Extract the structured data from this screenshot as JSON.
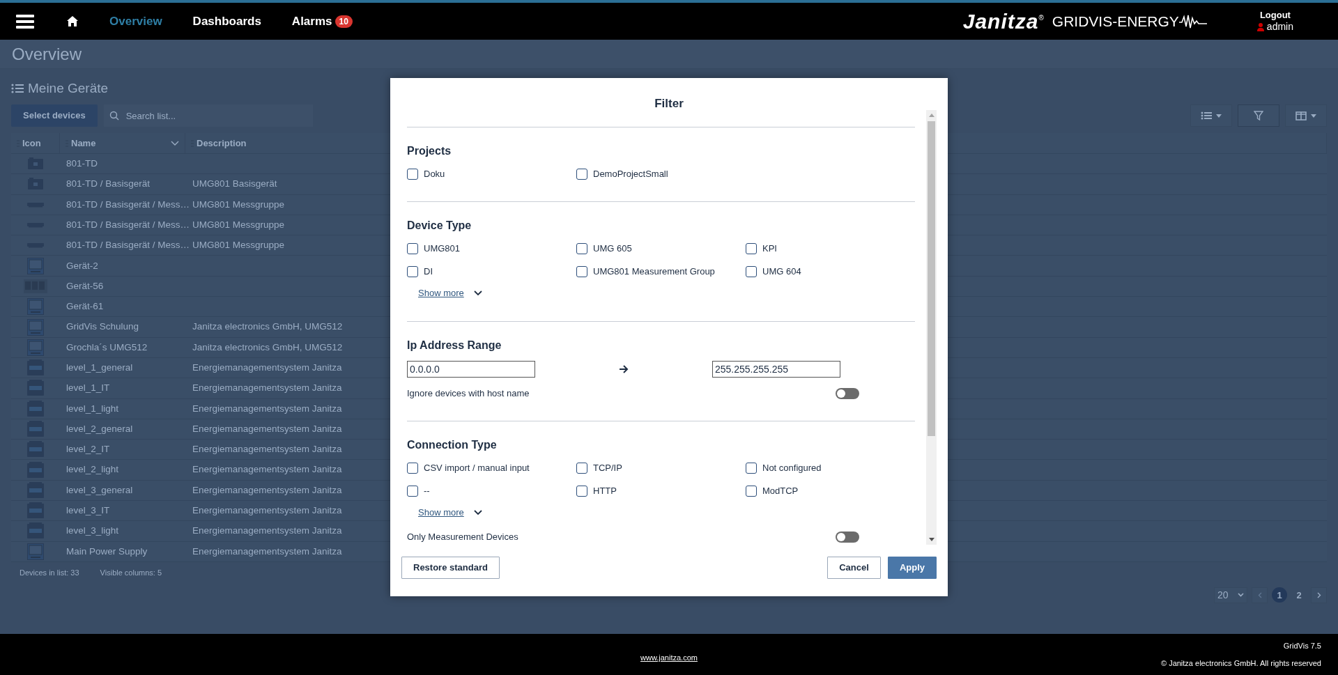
{
  "header": {
    "nav": [
      {
        "kind": "home",
        "selected": false
      },
      {
        "kind": "link",
        "label": "Overview",
        "selected": true
      },
      {
        "kind": "link",
        "label": "Dashboards",
        "selected": false
      },
      {
        "kind": "link",
        "label": "Alarms",
        "selected": false,
        "badge": "10"
      }
    ],
    "logo": {
      "brand": "Janitza",
      "mark": "®",
      "product": "GRIDVIS-ENERGY"
    },
    "user": {
      "logout": "Logout",
      "name": "admin"
    }
  },
  "page": {
    "title": "Overview",
    "list_title": "Meine Geräte",
    "select_button": "Select devices",
    "search": {
      "placeholder": "Search list..."
    },
    "columns": [
      "Icon",
      "Name",
      "Description"
    ],
    "rows": [
      {
        "kind": "module",
        "name": "801-TD"
      },
      {
        "kind": "module",
        "name": "801-TD / Basisgerät",
        "description": "UMG801 Basisgerät"
      },
      {
        "kind": "bar",
        "name": "801-TD / Basisgerät / Mess…",
        "description": "UMG801 Messgruppe"
      },
      {
        "kind": "bar",
        "name": "801-TD / Basisgerät / Mess…",
        "description": "UMG801 Messgruppe"
      },
      {
        "kind": "bar",
        "name": "801-TD / Basisgerät / Mess…",
        "description": "UMG801 Messgruppe"
      },
      {
        "kind": "screen",
        "name": "Gerät-2"
      },
      {
        "kind": "rack",
        "name": "Gerät-56"
      },
      {
        "kind": "screen",
        "name": "Gerät-61"
      },
      {
        "kind": "screen",
        "name": "GridVis Schulung",
        "description": "Janitza electronics GmbH, UMG512"
      },
      {
        "kind": "screen",
        "name": "Grochla´s UMG512",
        "description": "Janitza electronics GmbH, UMG512"
      },
      {
        "kind": "cabinet",
        "name": "level_1_general",
        "description": "Energiemanagementsystem Janitza"
      },
      {
        "kind": "cabinet",
        "name": "level_1_IT",
        "description": "Energiemanagementsystem Janitza"
      },
      {
        "kind": "cabinet",
        "name": "level_1_light",
        "description": "Energiemanagementsystem Janitza"
      },
      {
        "kind": "cabinet",
        "name": "level_2_general",
        "description": "Energiemanagementsystem Janitza"
      },
      {
        "kind": "cabinet",
        "name": "level_2_IT",
        "description": "Energiemanagementsystem Janitza"
      },
      {
        "kind": "cabinet",
        "name": "level_2_light",
        "description": "Energiemanagementsystem Janitza"
      },
      {
        "kind": "cabinet",
        "name": "level_3_general",
        "description": "Energiemanagementsystem Janitza"
      },
      {
        "kind": "cabinet",
        "name": "level_3_IT",
        "description": "Energiemanagementsystem Janitza"
      },
      {
        "kind": "cabinet",
        "name": "level_3_light",
        "description": "Energiemanagementsystem Janitza"
      },
      {
        "kind": "screen",
        "name": "Main Power Supply",
        "description": "Energiemanagementsystem Janitza"
      }
    ],
    "summary": [
      {
        "label": "Devices in list:",
        "value": "33"
      },
      {
        "label": "Visible columns:",
        "value": "5"
      }
    ],
    "pagination": {
      "page_size": "20",
      "pages": [
        {
          "label": "1",
          "selected": true
        },
        {
          "label": "2",
          "selected": false
        }
      ]
    }
  },
  "modal": {
    "title": "Filter",
    "sections": [
      {
        "kind": "checkboxes",
        "title": "Projects",
        "options": [
          {
            "label": "Doku",
            "checked": false
          },
          {
            "label": "DemoProjectSmall",
            "checked": false
          }
        ]
      },
      {
        "kind": "checkboxes",
        "title": "Device Type",
        "options": [
          {
            "label": "UMG801",
            "checked": false
          },
          {
            "label": "UMG 605",
            "checked": false
          },
          {
            "label": "KPI",
            "checked": false
          },
          {
            "label": "DI",
            "checked": false
          },
          {
            "label": "UMG801 Measurement Group",
            "checked": false
          },
          {
            "label": "UMG 604",
            "checked": false
          }
        ],
        "show_more": "Show more"
      },
      {
        "kind": "ip_range",
        "title": "Ip Address Range",
        "from": "0.0.0.0",
        "to": "255.255.255.255",
        "toggle": {
          "label": "Ignore devices with host name",
          "on": false
        }
      },
      {
        "kind": "checkboxes",
        "title": "Connection Type",
        "options": [
          {
            "label": "CSV import / manual input",
            "checked": false
          },
          {
            "label": "TCP/IP",
            "checked": false
          },
          {
            "label": "Not configured",
            "checked": false
          },
          {
            "label": "--",
            "checked": false
          },
          {
            "label": "HTTP",
            "checked": false
          },
          {
            "label": "ModTCP",
            "checked": false
          }
        ],
        "show_more": "Show more",
        "toggle": {
          "label": "Only Measurement Devices",
          "on": false
        }
      }
    ],
    "buttons": [
      {
        "kind": "secondary",
        "label": "Restore standard"
      },
      {
        "kind": "secondary",
        "label": "Cancel"
      },
      {
        "kind": "primary",
        "label": "Apply"
      }
    ]
  },
  "footer": {
    "link": "www.janitza.com",
    "version": "GridVis 7.5",
    "copyright": "© Janitza electronics GmbH. All rights reserved"
  }
}
